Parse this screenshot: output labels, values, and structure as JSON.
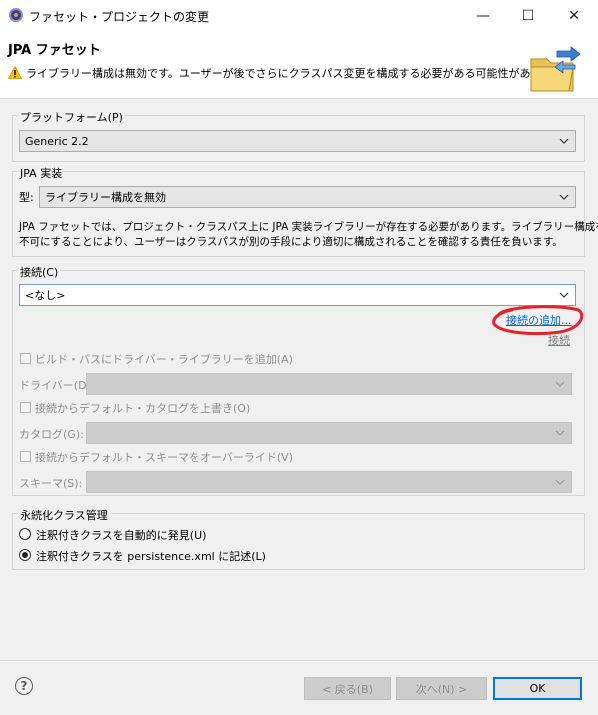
{
  "window": {
    "title": "ファセット・プロジェクトの変更",
    "minimize": "—",
    "maximize": "☐",
    "close": "✕"
  },
  "banner": {
    "title": "JPA ファセット",
    "message": "ライブラリー構成は無効です。ユーザーが後でさらにクラスパス変更を構成する必要がある可能性があります。"
  },
  "platform": {
    "label": "プラットフォーム(P)",
    "value": "Generic 2.2"
  },
  "jpa_impl": {
    "label": "JPA 実装",
    "type_label": "型:",
    "type_value": "ライブラリー構成を無効",
    "description_line1": "JPA ファセットでは、プロジェクト・クラスパス上に JPA 実装ライブラリーが存在する必要があります。ライブラリー構成を使用",
    "description_line2": "不可にすることにより、ユーザーはクラスパスが別の手段により適切に構成されることを確認する責任を負います。"
  },
  "connection": {
    "label": "接続(C)",
    "value": "<なし>",
    "add_link": "接続の追加...",
    "connect_link": "接続",
    "add_driver_check": "ビルド・パスにドライバー・ライブラリーを追加(A)",
    "driver_label": "ドライバー(D):",
    "override_catalog_check": "接続からデフォルト・カタログを上書き(O)",
    "catalog_label": "カタログ(G):",
    "override_schema_check": "接続からデフォルト・スキーマをオーバーライド(V)",
    "schema_label": "スキーマ(S):"
  },
  "persistence": {
    "label": "永続化クラス管理",
    "option_auto": "注釈付きクラスを自動的に発見(U)",
    "option_xml": "注釈付きクラスを persistence.xml に記述(L)",
    "selected": "option_xml"
  },
  "footer": {
    "help": "?",
    "back": "< 戻る(B)",
    "next": "次へ(N) >",
    "ok": "OK"
  },
  "colors": {
    "annotation": "#e8202a",
    "link": "#0066cc",
    "focus": "#0078d7"
  }
}
